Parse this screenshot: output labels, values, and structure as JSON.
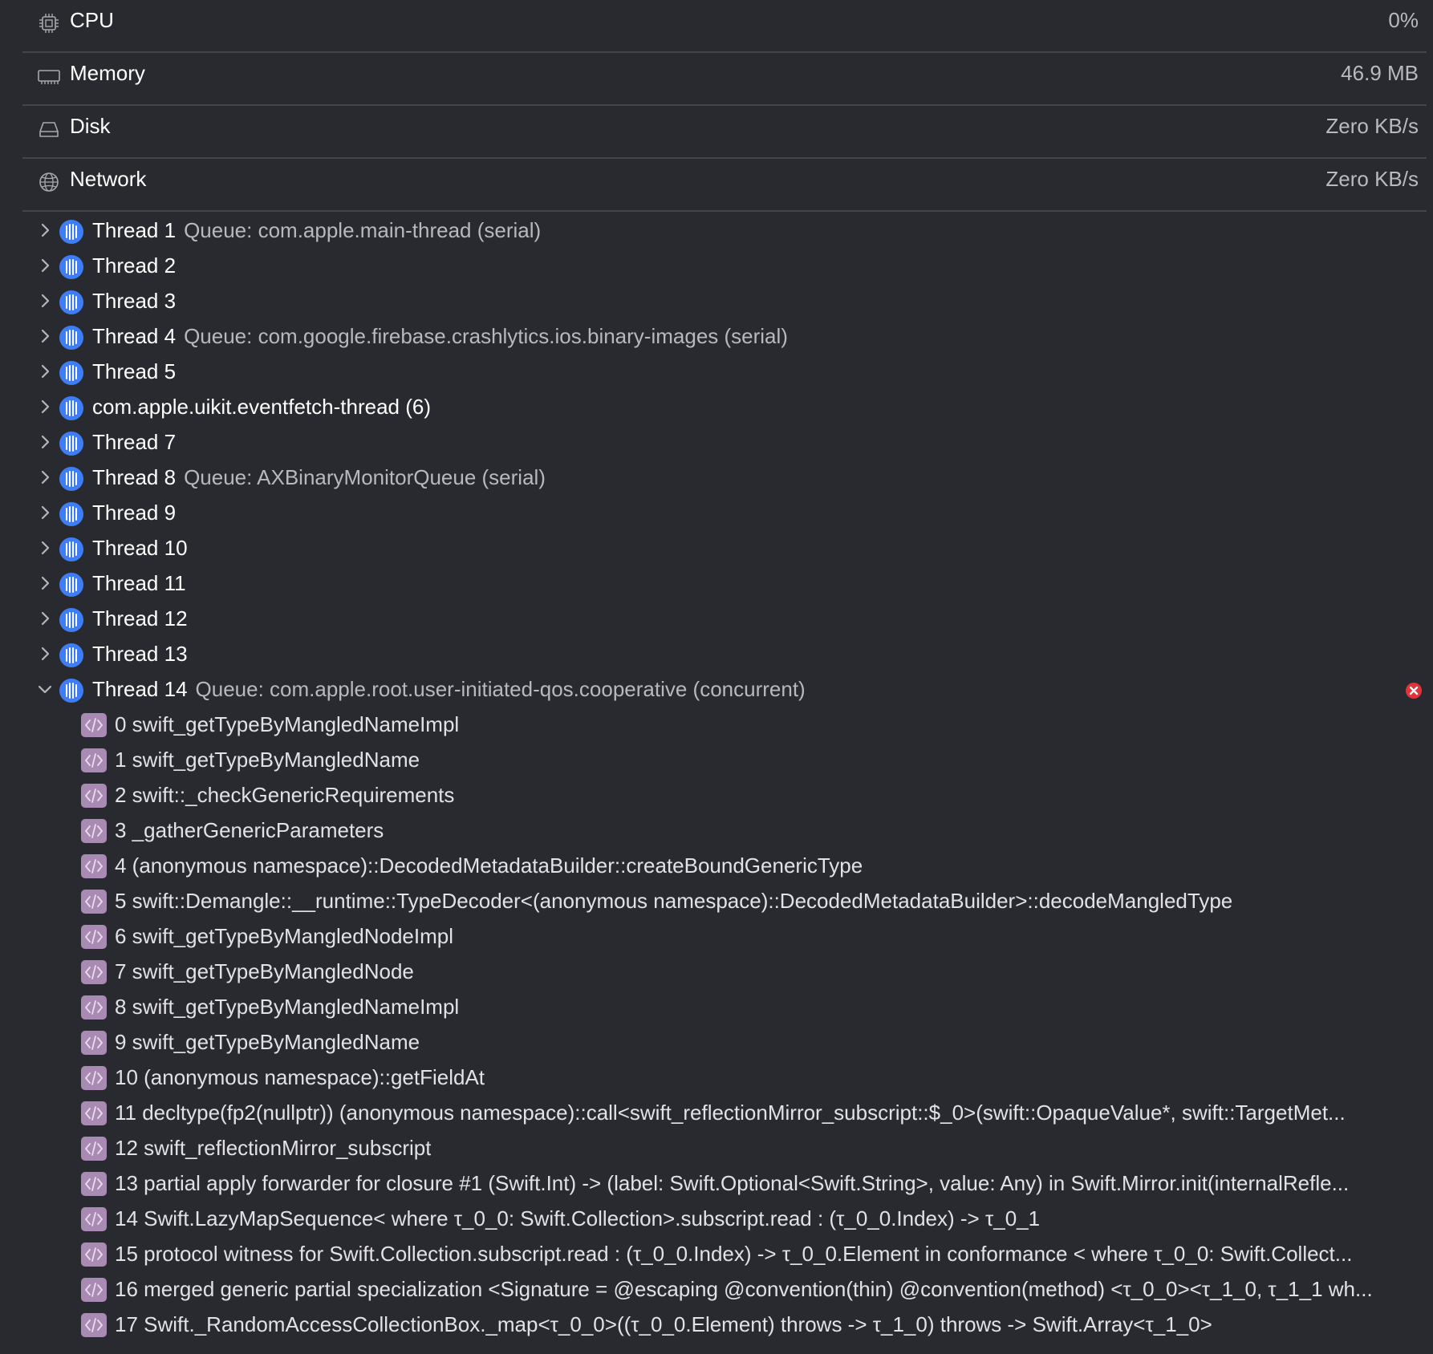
{
  "gauges": [
    {
      "label": "CPU",
      "value": "0%",
      "icon": "cpu-icon"
    },
    {
      "label": "Memory",
      "value": "46.9 MB",
      "icon": "memory-icon"
    },
    {
      "label": "Disk",
      "value": "Zero KB/s",
      "icon": "disk-icon"
    },
    {
      "label": "Network",
      "value": "Zero KB/s",
      "icon": "network-icon"
    }
  ],
  "threads": [
    {
      "name": "Thread 1",
      "queue": "Queue: com.apple.main-thread (serial)"
    },
    {
      "name": "Thread 2",
      "queue": ""
    },
    {
      "name": "Thread 3",
      "queue": ""
    },
    {
      "name": "Thread 4",
      "queue": "Queue: com.google.firebase.crashlytics.ios.binary-images (serial)"
    },
    {
      "name": "Thread 5",
      "queue": ""
    },
    {
      "name": "com.apple.uikit.eventfetch-thread (6)",
      "queue": ""
    },
    {
      "name": "Thread 7",
      "queue": ""
    },
    {
      "name": "Thread 8",
      "queue": "Queue: AXBinaryMonitorQueue (serial)"
    },
    {
      "name": "Thread 9",
      "queue": ""
    },
    {
      "name": "Thread 10",
      "queue": ""
    },
    {
      "name": "Thread 11",
      "queue": ""
    },
    {
      "name": "Thread 12",
      "queue": ""
    },
    {
      "name": "Thread 13",
      "queue": ""
    }
  ],
  "expanded_thread": {
    "name": "Thread 14",
    "queue": "Queue: com.apple.root.user-initiated-qos.cooperative (concurrent)",
    "frames": [
      "0 swift_getTypeByMangledNameImpl",
      "1 swift_getTypeByMangledName",
      "2 swift::_checkGenericRequirements",
      "3 _gatherGenericParameters",
      "4 (anonymous namespace)::DecodedMetadataBuilder::createBoundGenericType",
      "5 swift::Demangle::__runtime::TypeDecoder<(anonymous namespace)::DecodedMetadataBuilder>::decodeMangledType",
      "6 swift_getTypeByMangledNodeImpl",
      "7 swift_getTypeByMangledNode",
      "8 swift_getTypeByMangledNameImpl",
      "9 swift_getTypeByMangledName",
      "10 (anonymous namespace)::getFieldAt",
      "11 decltype(fp2(nullptr)) (anonymous namespace)::call<swift_reflectionMirror_subscript::$_0>(swift::OpaqueValue*, swift::TargetMet...",
      "12 swift_reflectionMirror_subscript",
      "13 partial apply forwarder for closure #1 (Swift.Int) -> (label: Swift.Optional<Swift.String>, value: Any) in Swift.Mirror.init(internalRefle...",
      "14 Swift.LazyMapSequence< where τ_0_0: Swift.Collection>.subscript.read : (τ_0_0.Index) -> τ_0_1",
      "15 protocol witness for Swift.Collection.subscript.read : (τ_0_0.Index) -> τ_0_0.Element in conformance < where τ_0_0: Swift.Collect...",
      "16 merged generic partial specialization <Signature = @escaping @convention(thin) @convention(method) <τ_0_0><τ_1_0, τ_1_1 wh...",
      "17 Swift._RandomAccessCollectionBox._map<τ_0_0>((τ_0_0.Element) throws -> τ_1_0) throws -> Swift.Array<τ_1_0>"
    ]
  },
  "colors": {
    "background": "#292a2f",
    "thread_icon": "#3d7ef7",
    "frame_icon": "#a98ab3",
    "error_badge": "#e0343a"
  }
}
